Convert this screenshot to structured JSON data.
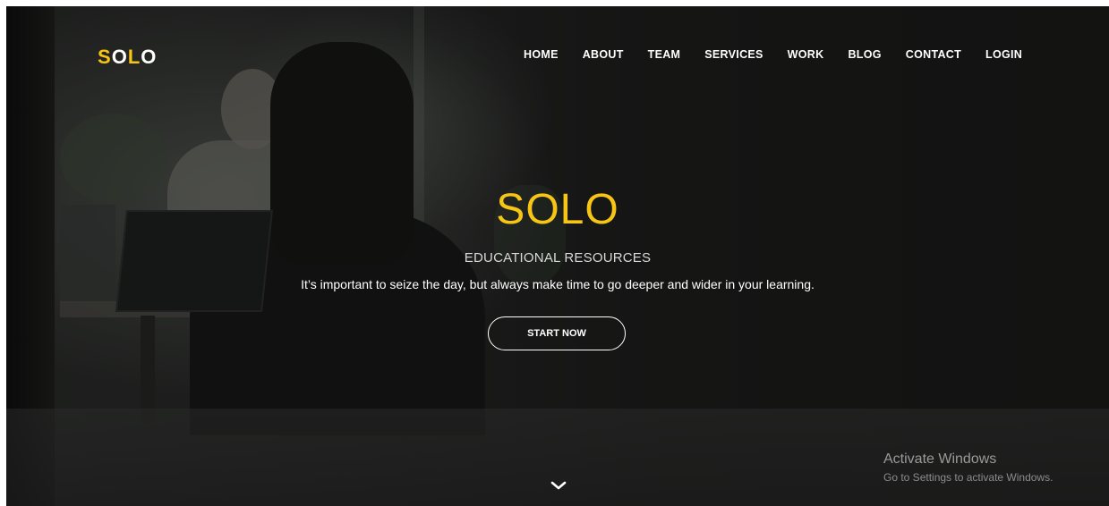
{
  "navbar": {
    "logo": {
      "part1": "S",
      "part2": "O",
      "part3": "L",
      "part4": "O"
    },
    "items": [
      {
        "label": "HOME"
      },
      {
        "label": "ABOUT"
      },
      {
        "label": "TEAM"
      },
      {
        "label": "SERVICES"
      },
      {
        "label": "WORK"
      },
      {
        "label": "BLOG"
      },
      {
        "label": "CONTACT"
      },
      {
        "label": "LOGIN"
      }
    ]
  },
  "hero": {
    "title": "SOLO",
    "subtitle": "EDUCATIONAL RESOURCES",
    "description": "It’s important to seize the day, but always make time to go deeper and wider in your learning.",
    "cta_label": "START NOW",
    "scroll_icon": "chevron-down-icon"
  },
  "watermark": {
    "title": "Activate Windows",
    "subtitle": "Go to Settings to activate Windows."
  },
  "colors": {
    "accent": "#f6c516",
    "text": "#ffffff",
    "background": "#1b1a19"
  }
}
